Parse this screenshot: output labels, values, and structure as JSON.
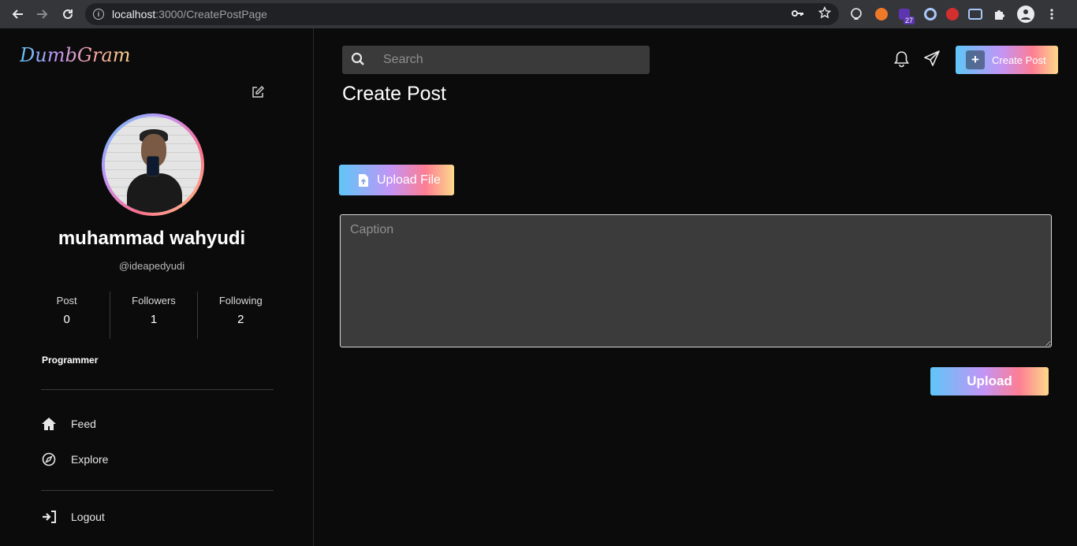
{
  "browser": {
    "url_host": "localhost",
    "url_path": ":3000/CreatePostPage",
    "extension_badge": "27"
  },
  "sidebar": {
    "logo": "DumbGram",
    "user": {
      "name": "muhammad wahyudi",
      "handle": "@ideapedyudi",
      "bio": "Programmer"
    },
    "stats": [
      {
        "label": "Post",
        "value": "0"
      },
      {
        "label": "Followers",
        "value": "1"
      },
      {
        "label": "Following",
        "value": "2"
      }
    ],
    "menu": [
      {
        "label": "Feed",
        "icon": "home-icon"
      },
      {
        "label": "Explore",
        "icon": "compass-icon"
      }
    ],
    "logout_label": "Logout"
  },
  "header": {
    "search_placeholder": "Search",
    "create_post_label": "Create Post"
  },
  "main": {
    "title": "Create Post",
    "upload_file_label": "Upload File",
    "caption_placeholder": "Caption",
    "upload_label": "Upload"
  },
  "colors": {
    "background": "#0b0b0c",
    "input_bg": "#3b3b3b",
    "gradient": [
      "#5ec6f7",
      "#c394f5",
      "#fd7e94",
      "#fcd98a"
    ]
  }
}
